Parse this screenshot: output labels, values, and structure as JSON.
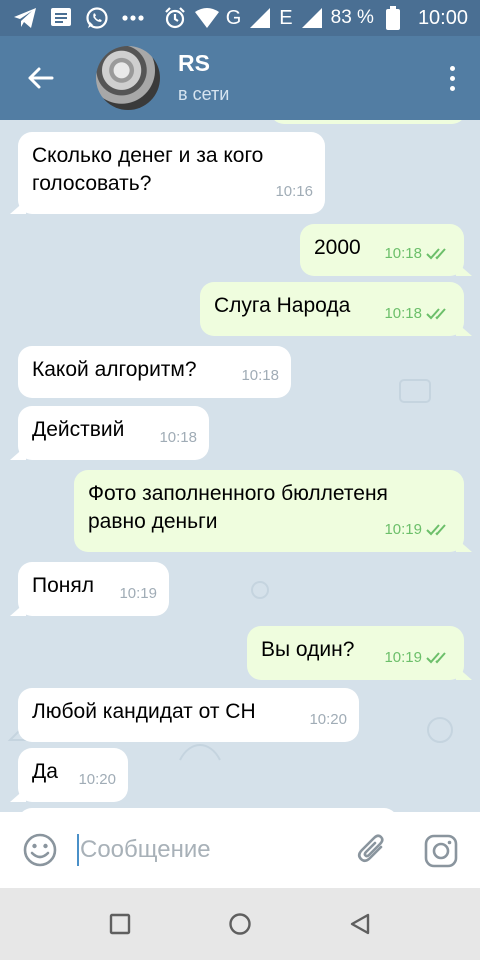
{
  "status_bar": {
    "network_letter_1": "G",
    "network_letter_2": "E",
    "battery": "83 %",
    "time": "10:00",
    "icons": [
      "telegram-icon",
      "message-icon",
      "whatsapp-icon",
      "more-dots-icon",
      "alarm-icon",
      "wifi-icon",
      "signal-icon",
      "battery-icon"
    ]
  },
  "header": {
    "title": "RS",
    "status": "в сети"
  },
  "messages": [
    {
      "dir": "in",
      "text": "Сколько денег и за кого голосовать?",
      "time": "10:16"
    },
    {
      "dir": "out",
      "text": "2000",
      "time": "10:18"
    },
    {
      "dir": "out",
      "text": "Слуга Народа",
      "time": "10:18"
    },
    {
      "dir": "in",
      "text": "Какой алгоритм?",
      "time": "10:18"
    },
    {
      "dir": "in",
      "text": "Действий",
      "time": "10:18"
    },
    {
      "dir": "out",
      "text": "Фото заполненного бюллетеня равно деньги",
      "time": "10:19"
    },
    {
      "dir": "in",
      "text": "Понял",
      "time": "10:19"
    },
    {
      "dir": "out",
      "text": "Вы один?",
      "time": "10:19"
    },
    {
      "dir": "in",
      "text": "Любой кандидат от СН",
      "time": "10:20"
    },
    {
      "dir": "in",
      "text": "Да",
      "time": "10:20"
    }
  ],
  "input": {
    "placeholder": "Сообщение",
    "value": ""
  },
  "colors": {
    "header": "#527da3",
    "status_bar": "#4a6f93",
    "chat_bg": "#d5e1ea",
    "bubble_in": "#ffffff",
    "bubble_out": "#effdde",
    "read_check": "#6cbf6a"
  }
}
